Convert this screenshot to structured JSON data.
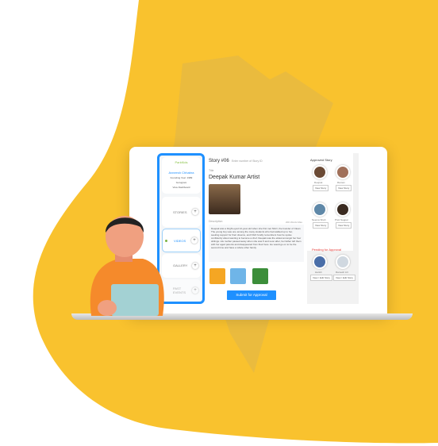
{
  "colors": {
    "accent": "#1e90ff",
    "yellow": "#F9C22E",
    "pending": "#e53935"
  },
  "sidebar": {
    "brand": "ParkKids",
    "name": "Avneesh Chhabra",
    "founding": "Founding Year: 1989",
    "location": "Gurugram",
    "dashboard": "View Dashboard",
    "items": [
      {
        "label": "STORIES"
      },
      {
        "label": "VIDEOS"
      },
      {
        "label": "GALLERY"
      },
      {
        "label": "PAST EVENTS"
      }
    ]
  },
  "main": {
    "story": "Story #06",
    "story_hint": "Enter number of Story ID",
    "title_label": "Title",
    "title": "Deepak Kumar Artist",
    "desc_label": "Description",
    "word_count": "200 Words Max",
    "description": "Deepak was a bright-eyed 12-year-old when she first met NGO, the founder of Clean. The young boy was one among the many students who had walked up to her, seeking support for their dreams, and NGO fondly remembers how he spoke confidently about wanting to become a chef. Deepak was the eldest amongst her four siblings. His mother passed away when she was 5 and soon after, her father left them with her aged parents and disappeared from their lives. He would go on to be the second time and have a whole other family.",
    "submit": "Submit for Approval"
  },
  "right": {
    "approved_title": "Approved Story",
    "approved": [
      {
        "name": "Deepak",
        "btn": "View Story"
      },
      {
        "name": "Raman",
        "btn": "View Story"
      },
      {
        "name": "Neema Shah",
        "btn": "View Story"
      },
      {
        "name": "Preti Nagpal",
        "btn": "View Story"
      }
    ],
    "pending_title": "Pending for Approval",
    "pending": [
      {
        "name": "Harish",
        "btn": "View / Edit Story"
      },
      {
        "name": "Ramesh Art",
        "btn": "View / Edit Story"
      }
    ]
  }
}
